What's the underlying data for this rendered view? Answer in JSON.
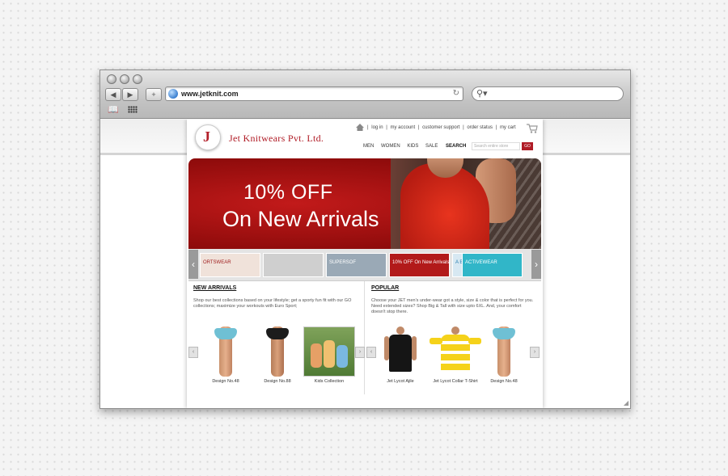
{
  "browser": {
    "url": "www.jetknit.com",
    "back_icon": "back-arrow-icon",
    "forward_icon": "forward-arrow-icon",
    "add_tab_label": "+",
    "reload_icon": "reload-icon",
    "search_icon": "magnifier-icon"
  },
  "site": {
    "brand": "Jet Knitwears Pvt. Ltd.",
    "top_links": [
      "log in",
      "my account",
      "customer support",
      "order status",
      "my cart"
    ],
    "categories": [
      "MEN",
      "WOMEN",
      "KIDS",
      "SALE"
    ],
    "search_label": "SEARCH",
    "search_placeholder": "Search entire store",
    "go_label": "GO",
    "hero": {
      "line1": "10% OFF",
      "line2": "On New Arrivals"
    },
    "thumbnails": [
      {
        "text": "ORTSWEAR",
        "color": "#f0e2da"
      },
      {
        "text": "",
        "color": "#cfcfcf"
      },
      {
        "text": "SUPERSOF",
        "color": "#9aa9b6"
      },
      {
        "text": "10% OFF On New Arrivals",
        "color": "#b21a1a"
      },
      {
        "text": "A BEAUTIFUL",
        "color": "#d7e8f2"
      },
      {
        "text": "ACTIVEWEAR",
        "color": "#31b6c8"
      }
    ],
    "new_arrivals": {
      "title": "NEW ARRIVALS",
      "description": "Shop our best collections based on your lifestyle; get a sporty fun fit with our GO collections; maximize your workouts with Euro Sport;",
      "products": [
        {
          "label": "Design No.48"
        },
        {
          "label": "Design No.88"
        },
        {
          "label": "Kids Collection"
        }
      ]
    },
    "popular": {
      "title": "POPULAR",
      "description": "Choose your JET men's under-wear got a style, size & color that is perfect for you. Need extended sizes? Shop Big & Tall with size upto 6XL. And, your comfort doesn't stop there.",
      "products": [
        {
          "label": "Jet Lycot Ajile"
        },
        {
          "label": "Jet Lycot Collar T-Shirt"
        },
        {
          "label": "Design No.48"
        }
      ]
    }
  },
  "colors": {
    "brand_red": "#b01c26",
    "hero_red": "#c21a1a"
  }
}
